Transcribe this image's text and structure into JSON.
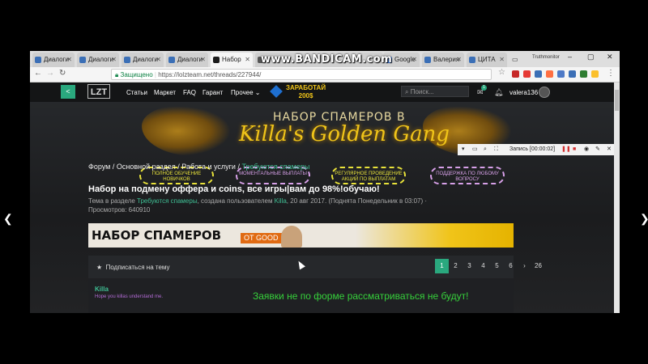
{
  "tabs": [
    {
      "label": "Диалоги"
    },
    {
      "label": "Диалоги"
    },
    {
      "label": "Диалоги"
    },
    {
      "label": "Диалоги"
    },
    {
      "label": "Набор"
    },
    {
      "label": ""
    },
    {
      "label": "Google"
    },
    {
      "label": "Валерия"
    },
    {
      "label": "ЦИТА"
    }
  ],
  "watermark": "www.BANDICAM.com",
  "profile_label": "Truthmonitor",
  "window": {
    "minimize": "–",
    "maximize": "▢",
    "close": "✕"
  },
  "address": {
    "secure_label": "Защищено",
    "url": "https://lolzteam.net/threads/227944/"
  },
  "site": {
    "back_label": "<",
    "logo": "LZT",
    "menu": [
      "Статьи",
      "Маркет",
      "FAQ",
      "Гарант",
      "Прочее ⌄"
    ],
    "promo_line1": "ЗАРАБОТАЙ",
    "promo_line2": "200$",
    "search_placeholder": "Поиск...",
    "username": "valera136",
    "notification_count": "1"
  },
  "banner": {
    "title_line1": "НАБОР СПАМЕРОВ В",
    "title_line2": "Killa's Golden Gang",
    "pills": [
      {
        "text": "ПОЛНОЕ ОБУЧЕНИЕ НОВИЧКОВ",
        "color": "#e8e23a"
      },
      {
        "text": "МОМЕНТАЛЬНЫЕ ВЫПЛАТЫ",
        "color": "#d7a0e8"
      },
      {
        "text": "РЕГУЛЯРНОЕ ПРОВЕДЕНИЕ АКЦИЙ ПО ВЫПЛАТАМ",
        "color": "#e8e23a"
      },
      {
        "text": "ПОДДЕРЖКА ПО ЛЮБОМУ ВОПРОСУ",
        "color": "#d7a0e8"
      }
    ]
  },
  "recorder": {
    "label": "Запись [00:00:02]"
  },
  "breadcrumb": {
    "items": [
      "Форум",
      "Основной раздел",
      "Работа и услуги",
      "Требуются спамеры"
    ],
    "sep": "/"
  },
  "thread": {
    "title": "Набор на подмену оффера и coins, все игры|вам до 98%!обучаю!",
    "meta_prefix": "Тема в разделе ",
    "meta_section": "Требуются спамеры",
    "meta_mid": ", создана пользователем ",
    "meta_author": "Killa",
    "meta_rest": ", 20 авг 2017. (Поднята Понедельник в 03:07)  ·",
    "views": "Просмотров: 640910"
  },
  "ad": {
    "text": "НАБОР СПАМЕРОВ",
    "sub": "ОТ GOOD"
  },
  "controls": {
    "subscribe": "Подписаться на тему",
    "pages": [
      "1",
      "2",
      "3",
      "4",
      "5",
      "6",
      "›",
      "26"
    ],
    "current_page": "1"
  },
  "post": {
    "author": "Killa",
    "author_title": "Hope you killas understand me.",
    "text": "Заявки не по форме рассматриваться не будут!"
  }
}
